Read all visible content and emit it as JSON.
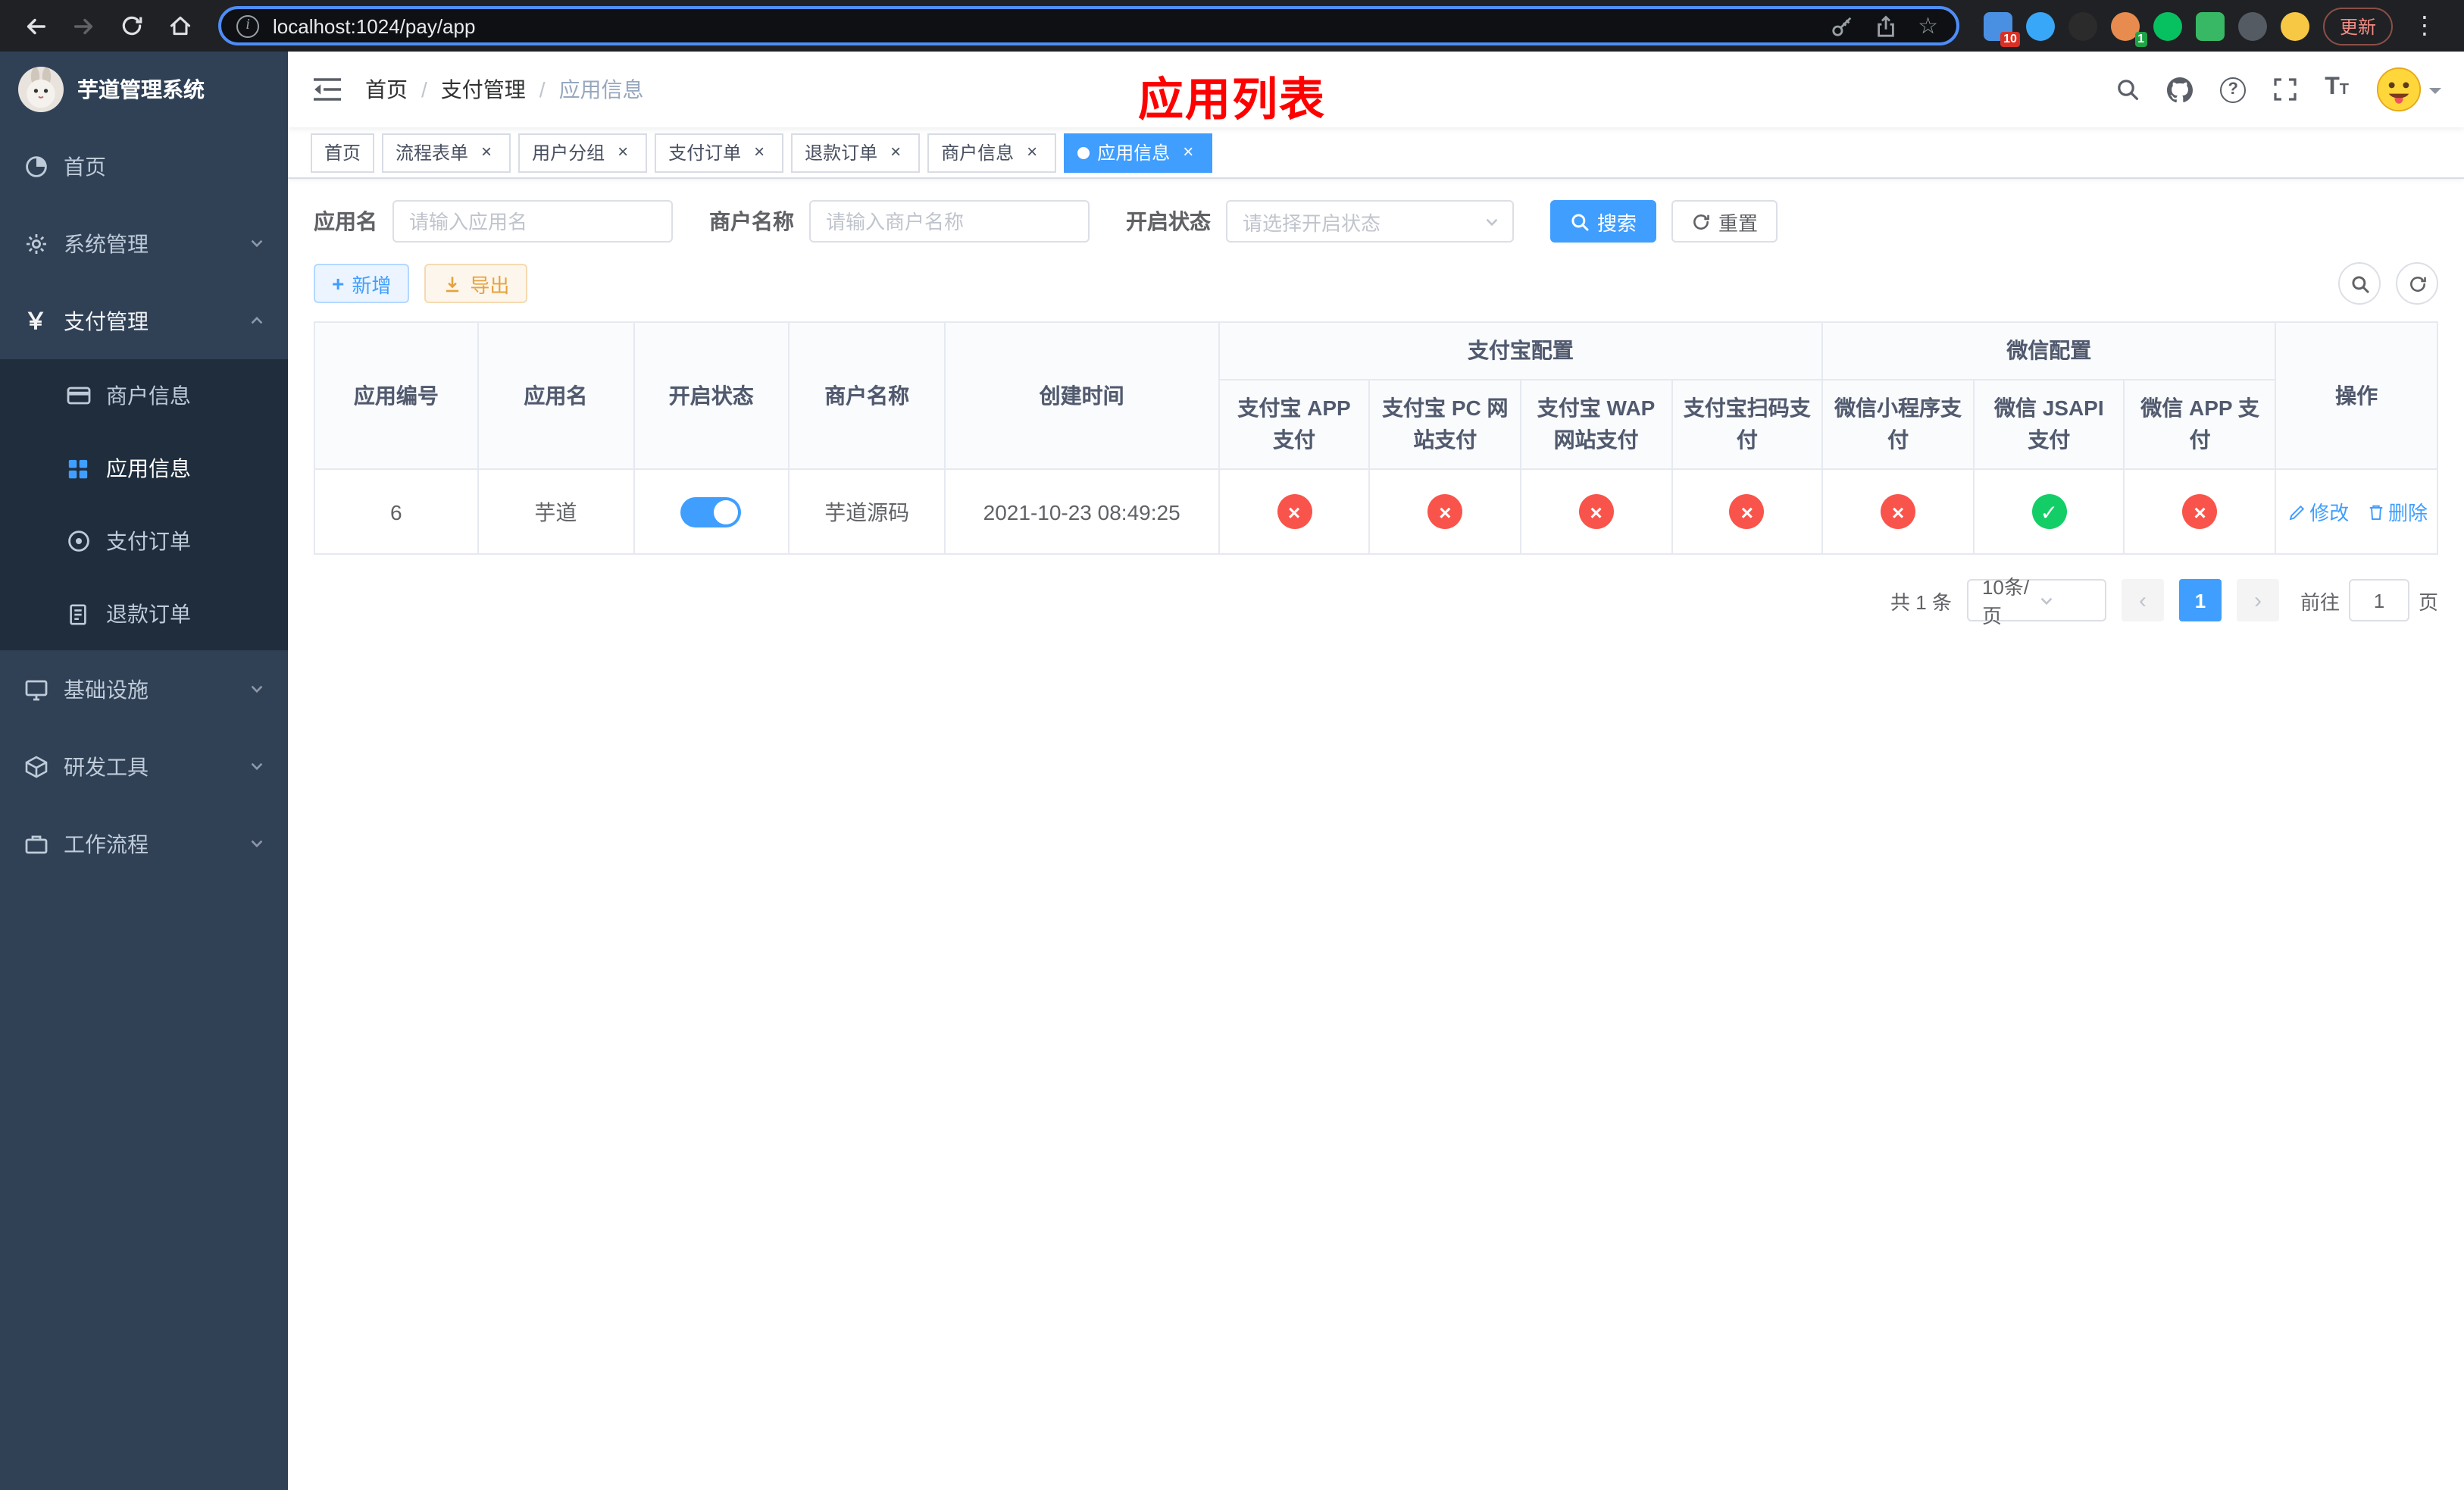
{
  "colors": {
    "primary": "#409eff",
    "success": "#13ce66",
    "danger": "#f9544b",
    "warning": "#e6a23c",
    "annotation_red": "#fe0000"
  },
  "browser": {
    "url": "localhost:1024/pay/app",
    "update_button": "更新",
    "extension_badge_count": "10",
    "profile_badge_count": "1"
  },
  "sidebar": {
    "logo_title": "芋道管理系统",
    "menu": [
      {
        "label": "首页"
      },
      {
        "label": "系统管理"
      },
      {
        "label": "支付管理",
        "children": [
          {
            "label": "商户信息"
          },
          {
            "label": "应用信息"
          },
          {
            "label": "支付订单"
          },
          {
            "label": "退款订单"
          }
        ]
      },
      {
        "label": "基础设施"
      },
      {
        "label": "研发工具"
      },
      {
        "label": "工作流程"
      }
    ]
  },
  "navbar": {
    "breadcrumb": [
      "首页",
      "支付管理",
      "应用信息"
    ],
    "breadcrumb_separator": "/",
    "page_title": "应用列表"
  },
  "tabs": [
    {
      "label": "首页"
    },
    {
      "label": "流程表单"
    },
    {
      "label": "用户分组"
    },
    {
      "label": "支付订单"
    },
    {
      "label": "退款订单"
    },
    {
      "label": "商户信息"
    },
    {
      "label": "应用信息"
    }
  ],
  "filters": {
    "app_name_label": "应用名",
    "app_name_placeholder": "请输入应用名",
    "merchant_label": "商户名称",
    "merchant_placeholder": "请输入商户名称",
    "status_label": "开启状态",
    "status_placeholder": "请选择开启状态",
    "search_button": "搜索",
    "reset_button": "重置"
  },
  "toolbar": {
    "add_button": "新增",
    "export_button": "导出"
  },
  "table": {
    "headers": {
      "app_id": "应用编号",
      "app_name": "应用名",
      "status": "开启状态",
      "merchant": "商户名称",
      "created": "创建时间",
      "alipay_group": "支付宝配置",
      "wechat_group": "微信配置",
      "ops": "操作",
      "config_columns": [
        "支付宝 APP 支付",
        "支付宝 PC 网站支付",
        "支付宝 WAP 网站支付",
        "支付宝扫码支付",
        "微信小程序支付",
        "微信 JSAPI 支付",
        "微信 APP 支付"
      ]
    },
    "rows": [
      {
        "app_id": "6",
        "app_name": "芋道",
        "status_on": true,
        "merchant": "芋道源码",
        "created": "2021-10-23 08:49:25",
        "configs": [
          false,
          false,
          false,
          false,
          false,
          true,
          false
        ],
        "edit_label": "修改",
        "delete_label": "删除"
      }
    ]
  },
  "pagination": {
    "total": "共 1 条",
    "page_size": "10条/页",
    "current_page": "1",
    "goto_prefix": "前往",
    "goto_value": "1",
    "goto_suffix": "页"
  }
}
